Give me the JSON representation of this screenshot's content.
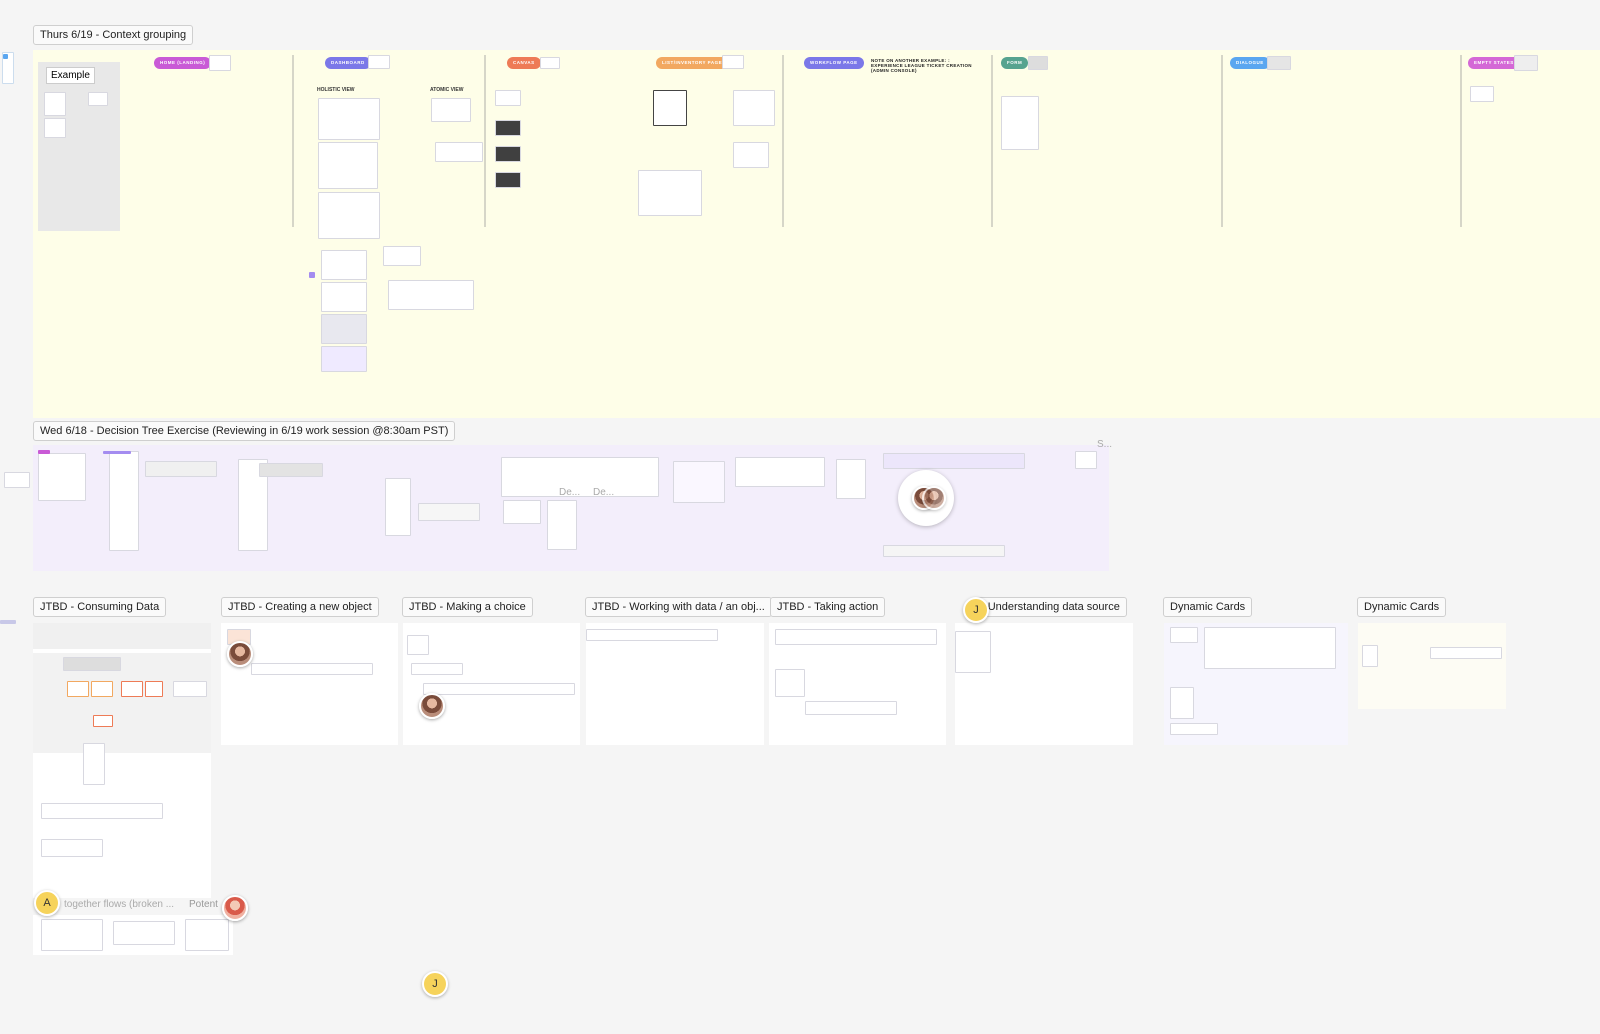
{
  "sections": {
    "context_grouping": {
      "label": "Thurs 6/19 - Context grouping"
    },
    "decision_tree": {
      "label": "Wed 6/18 - Decision Tree Exercise (Reviewing in 6/19 work session @8:30am PST)"
    }
  },
  "example_label": "Example",
  "columns": [
    {
      "label": "HOME (LANDING)",
      "color": "#c95ad6"
    },
    {
      "label": "DASHBOARD",
      "color": "#7b78e8"
    },
    {
      "label": "CANVAS",
      "color": "#ee7b56"
    },
    {
      "label": "LIST/INVENTORY PAGE",
      "color": "#f2a860"
    },
    {
      "label": "WORKFLOW PAGE",
      "color": "#7b78e8"
    },
    {
      "label": "FORM",
      "color": "#56a38f"
    },
    {
      "label": "DIALOGUE",
      "color": "#5aa6f0"
    },
    {
      "label": "EMPTY STATES",
      "color": "#d468d6"
    }
  ],
  "dashboard_sub": {
    "holistic": "HOLISTIC VIEW",
    "atomic": "ATOMIC VIEW"
  },
  "workflow_note": "NOTE ON ANOTHER EXAMPLE: : EXPERIENCE LEAGUE TICKET CREATION (ADMIN CONSOLE)",
  "jtbd_labels": [
    "JTBD - Consuming Data",
    "JTBD - Creating a new object",
    "JTBD - Making a choice",
    "JTBD - Working with data / an obj...",
    "JTBD - Taking action",
    "- Understanding data source",
    "Dynamic Cards",
    "Dynamic Cards"
  ],
  "faded_labels": {
    "de1": "De...",
    "de2": "De...",
    "s": "S...",
    "flows": "together flows (broken ...",
    "potent": "Potent"
  },
  "cursors": {
    "a": "A",
    "j1": "J",
    "j2": "J"
  },
  "colors": {
    "canvas": "#f5f5f5",
    "yellow_section": "#fefee8",
    "purple_section": "#f3eefb"
  }
}
